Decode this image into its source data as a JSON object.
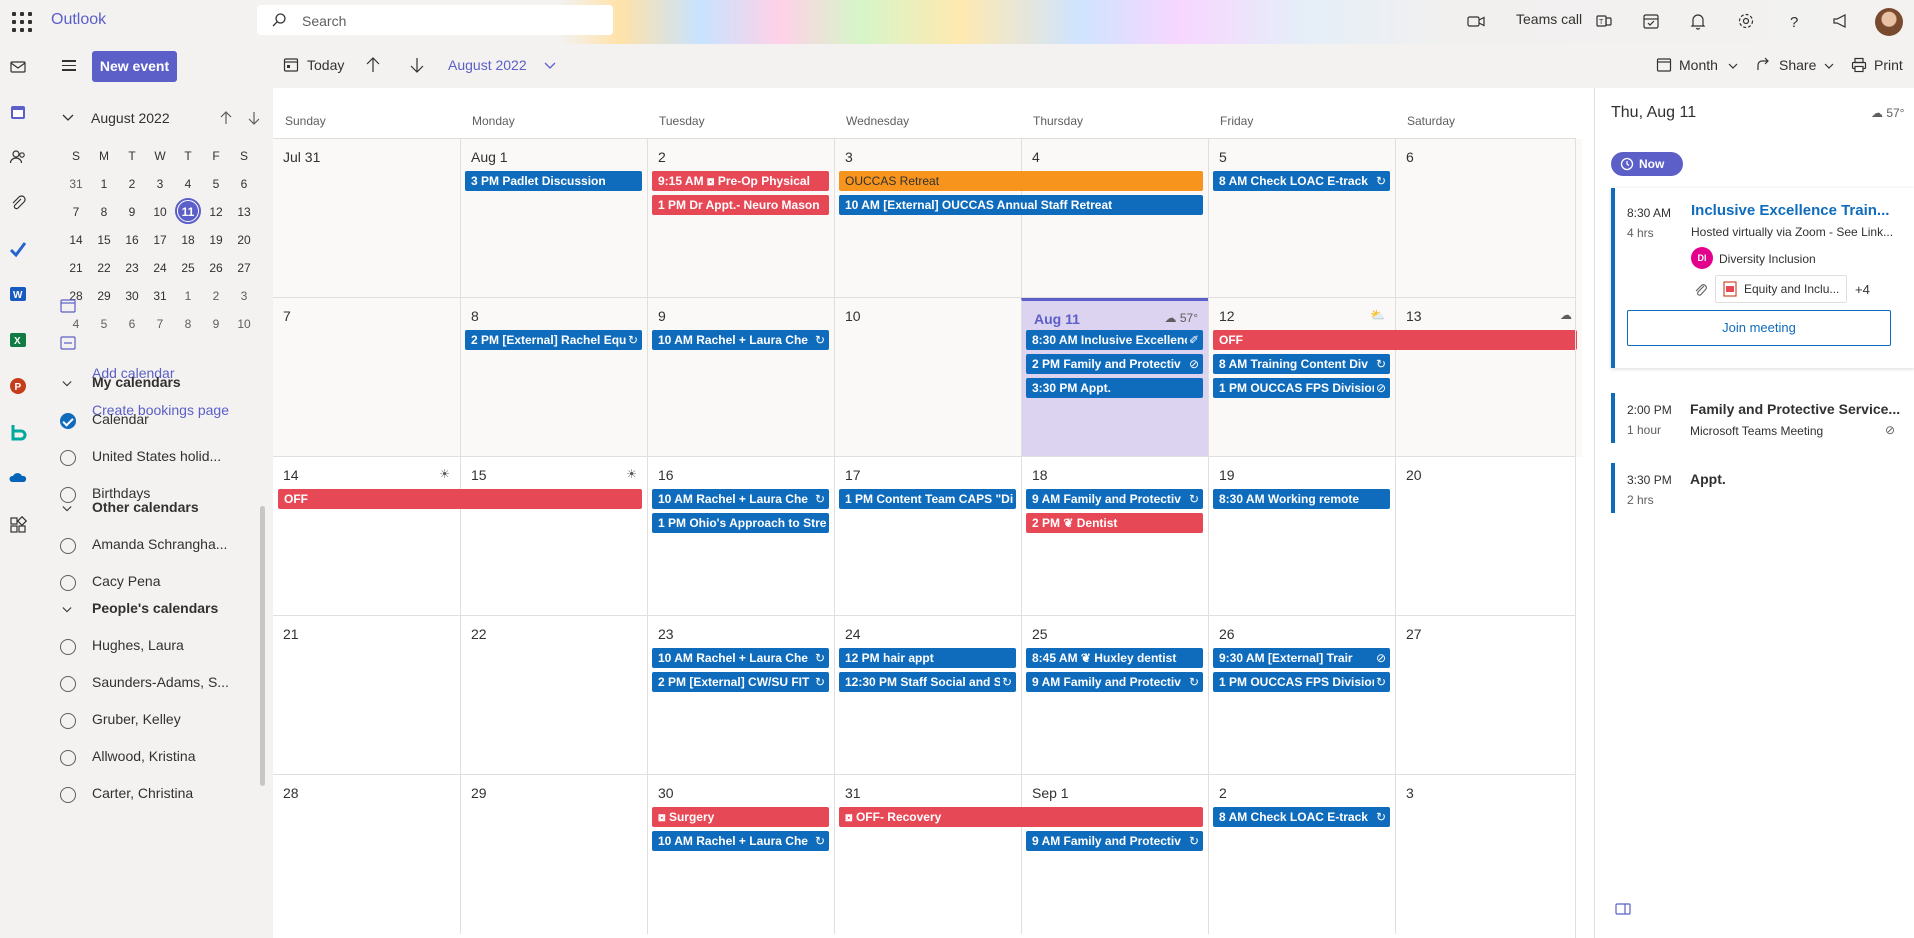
{
  "app": {
    "brand": "Outlook"
  },
  "search": {
    "placeholder": "Search"
  },
  "topbar": {
    "teams_call": "Teams call"
  },
  "pane": {
    "new_event": "New event",
    "mini": {
      "title": "August 2022",
      "dow": [
        "S",
        "M",
        "T",
        "W",
        "T",
        "F",
        "S"
      ],
      "weeks": [
        [
          "31",
          "1",
          "2",
          "3",
          "4",
          "5",
          "6"
        ],
        [
          "7",
          "8",
          "9",
          "10",
          "11",
          "12",
          "13"
        ],
        [
          "14",
          "15",
          "16",
          "17",
          "18",
          "19",
          "20"
        ],
        [
          "21",
          "22",
          "23",
          "24",
          "25",
          "26",
          "27"
        ],
        [
          "28",
          "29",
          "30",
          "31",
          "1",
          "2",
          "3"
        ],
        [
          "4",
          "5",
          "6",
          "7",
          "8",
          "9",
          "10"
        ]
      ],
      "selected": "11"
    },
    "add_calendar": "Add calendar",
    "create_bookings": "Create bookings page",
    "my_calendars": {
      "title": "My calendars",
      "items": [
        {
          "label": "Calendar",
          "checked": true
        },
        {
          "label": "United States holid...",
          "checked": false
        },
        {
          "label": "Birthdays",
          "checked": false
        }
      ]
    },
    "other_calendars": {
      "title": "Other calendars",
      "items": [
        {
          "label": "Amanda Schrangha...",
          "checked": false
        },
        {
          "label": "Cacy Pena",
          "checked": false
        }
      ]
    },
    "peoples_calendars": {
      "title": "People's calendars",
      "items": [
        {
          "label": "Hughes, Laura",
          "checked": false
        },
        {
          "label": "Saunders-Adams, S...",
          "checked": false
        },
        {
          "label": "Gruber, Kelley",
          "checked": false
        },
        {
          "label": "Allwood, Kristina",
          "checked": false
        },
        {
          "label": "Carter, Christina",
          "checked": false
        }
      ]
    }
  },
  "cmdbar": {
    "today": "Today",
    "month_label": "August 2022",
    "view": "Month",
    "share": "Share",
    "print": "Print"
  },
  "grid": {
    "days_of_week": [
      "Sunday",
      "Monday",
      "Tuesday",
      "Wednesday",
      "Thursday",
      "Friday",
      "Saturday"
    ],
    "weeks": [
      {
        "days": [
          "Jul 31",
          "Aug 1",
          "2",
          "3",
          "4",
          "5",
          "6"
        ],
        "weather": {},
        "events": [
          {
            "day": 1,
            "slot": 0,
            "span": 1,
            "color": "blue",
            "text": "3 PM Padlet Discussion",
            "icon": ""
          },
          {
            "day": 2,
            "slot": 0,
            "span": 1,
            "color": "red",
            "text": "9:15 AM ⧇ Pre-Op Physical",
            "icon": ""
          },
          {
            "day": 2,
            "slot": 1,
            "span": 1,
            "color": "red",
            "text": "1 PM Dr Appt.- Neuro Mason",
            "icon": ""
          },
          {
            "day": 3,
            "slot": 0,
            "span": 2,
            "color": "orange",
            "text": "OUCCAS Retreat",
            "icon": ""
          },
          {
            "day": 3,
            "slot": 1,
            "span": 2,
            "color": "blue",
            "text": "10 AM [External] OUCCAS Annual Staff Retreat",
            "icon": ""
          },
          {
            "day": 5,
            "slot": 0,
            "span": 1,
            "color": "blue",
            "text": "8 AM Check LOAC E-track",
            "icon": "↻"
          }
        ]
      },
      {
        "days": [
          "7",
          "8",
          "9",
          "10",
          "Aug 11",
          "12",
          "13"
        ],
        "weather": {
          "4": "☁ 57°",
          "5": "⛅",
          "6": "☁"
        },
        "today_index": 4,
        "events": [
          {
            "day": 1,
            "slot": 0,
            "span": 1,
            "color": "blue",
            "text": "2 PM [External] Rachel Equ",
            "icon": "↻"
          },
          {
            "day": 2,
            "slot": 0,
            "span": 1,
            "color": "blue",
            "text": "10 AM Rachel + Laura Che",
            "icon": "↻"
          },
          {
            "day": 4,
            "slot": 0,
            "span": 1,
            "color": "blue",
            "text": "8:30 AM Inclusive Excellenc",
            "icon": "✐"
          },
          {
            "day": 4,
            "slot": 1,
            "span": 1,
            "color": "blue",
            "text": "2 PM Family and Protectiv",
            "icon": "⊘"
          },
          {
            "day": 4,
            "slot": 2,
            "span": 1,
            "color": "blue",
            "text": "3:30 PM Appt.",
            "icon": ""
          },
          {
            "day": 5,
            "slot": 0,
            "span": 2,
            "color": "red",
            "text": "OFF",
            "icon": ""
          },
          {
            "day": 5,
            "slot": 1,
            "span": 1,
            "color": "blue",
            "text": "8 AM Training Content Div",
            "icon": "↻"
          },
          {
            "day": 5,
            "slot": 2,
            "span": 1,
            "color": "blue",
            "text": "1 PM OUCCAS FPS Division",
            "icon": "⊘"
          }
        ]
      },
      {
        "days": [
          "14",
          "15",
          "16",
          "17",
          "18",
          "19",
          "20"
        ],
        "weather": {
          "0": "☀",
          "1": "☀"
        },
        "events": [
          {
            "day": 0,
            "slot": 0,
            "span": 2,
            "color": "red",
            "text": "OFF",
            "icon": ""
          },
          {
            "day": 2,
            "slot": 0,
            "span": 1,
            "color": "blue",
            "text": "10 AM Rachel + Laura Che",
            "icon": "↻"
          },
          {
            "day": 2,
            "slot": 1,
            "span": 1,
            "color": "blue",
            "text": "1 PM Ohio's Approach to Stre",
            "icon": ""
          },
          {
            "day": 3,
            "slot": 0,
            "span": 1,
            "color": "blue",
            "text": "1 PM Content Team CAPS \"Di",
            "icon": ""
          },
          {
            "day": 4,
            "slot": 0,
            "span": 1,
            "color": "blue",
            "text": "9 AM Family and Protectiv",
            "icon": "↻"
          },
          {
            "day": 4,
            "slot": 1,
            "span": 1,
            "color": "red",
            "text": "2 PM ❦ Dentist",
            "icon": ""
          },
          {
            "day": 5,
            "slot": 0,
            "span": 1,
            "color": "blue",
            "text": "8:30 AM Working remote",
            "icon": ""
          }
        ]
      },
      {
        "days": [
          "21",
          "22",
          "23",
          "24",
          "25",
          "26",
          "27"
        ],
        "weather": {},
        "events": [
          {
            "day": 2,
            "slot": 0,
            "span": 1,
            "color": "blue",
            "text": "10 AM Rachel + Laura Che",
            "icon": "↻"
          },
          {
            "day": 2,
            "slot": 1,
            "span": 1,
            "color": "blue",
            "text": "2 PM [External] CW/SU FIT",
            "icon": "↻"
          },
          {
            "day": 3,
            "slot": 0,
            "span": 1,
            "color": "blue",
            "text": "12 PM hair appt",
            "icon": ""
          },
          {
            "day": 3,
            "slot": 1,
            "span": 1,
            "color": "blue",
            "text": "12:30 PM Staff Social and S",
            "icon": "↻"
          },
          {
            "day": 4,
            "slot": 0,
            "span": 1,
            "color": "blue",
            "text": "8:45 AM ❦ Huxley dentist",
            "icon": ""
          },
          {
            "day": 4,
            "slot": 1,
            "span": 1,
            "color": "blue",
            "text": "9 AM Family and Protectiv",
            "icon": "↻"
          },
          {
            "day": 5,
            "slot": 0,
            "span": 1,
            "color": "blue",
            "text": "9:30 AM [External] Trair",
            "icon": "⊘"
          },
          {
            "day": 5,
            "slot": 1,
            "span": 1,
            "color": "blue",
            "text": "1 PM OUCCAS FPS Division",
            "icon": "↻"
          }
        ]
      },
      {
        "days": [
          "28",
          "29",
          "30",
          "31",
          "Sep 1",
          "2",
          "3"
        ],
        "weather": {},
        "events": [
          {
            "day": 2,
            "slot": 0,
            "span": 1,
            "color": "red",
            "text": "⧇ Surgery",
            "icon": ""
          },
          {
            "day": 2,
            "slot": 1,
            "span": 1,
            "color": "blue",
            "text": "10 AM Rachel + Laura Che",
            "icon": "↻"
          },
          {
            "day": 3,
            "slot": 0,
            "span": 2,
            "color": "red",
            "text": "⧇ OFF- Recovery",
            "icon": ""
          },
          {
            "day": 4,
            "slot": 1,
            "span": 1,
            "color": "blue",
            "text": "9 AM Family and Protectiv",
            "icon": "↻"
          },
          {
            "day": 5,
            "slot": 0,
            "span": 1,
            "color": "blue",
            "text": "8 AM Check LOAC E-track",
            "icon": "↻"
          }
        ]
      }
    ]
  },
  "rpane": {
    "date": "Thu, Aug 11",
    "weather": "☁ 57°",
    "now": "Now",
    "card": {
      "time": "8:30 AM",
      "duration": "4 hrs",
      "title": "Inclusive Excellence Train...",
      "location": "Hosted virtually via Zoom - See Link...",
      "organizer_initials": "DI",
      "organizer": "Diversity Inclusion",
      "attachment": "Equity and Inclu...",
      "more": "+4",
      "join": "Join meeting"
    },
    "agenda": [
      {
        "time": "2:00 PM",
        "duration": "1 hour",
        "title": "Family and Protective Service...",
        "sub": "Microsoft Teams Meeting"
      },
      {
        "time": "3:30 PM",
        "duration": "2 hrs",
        "title": "Appt.",
        "sub": ""
      }
    ]
  }
}
